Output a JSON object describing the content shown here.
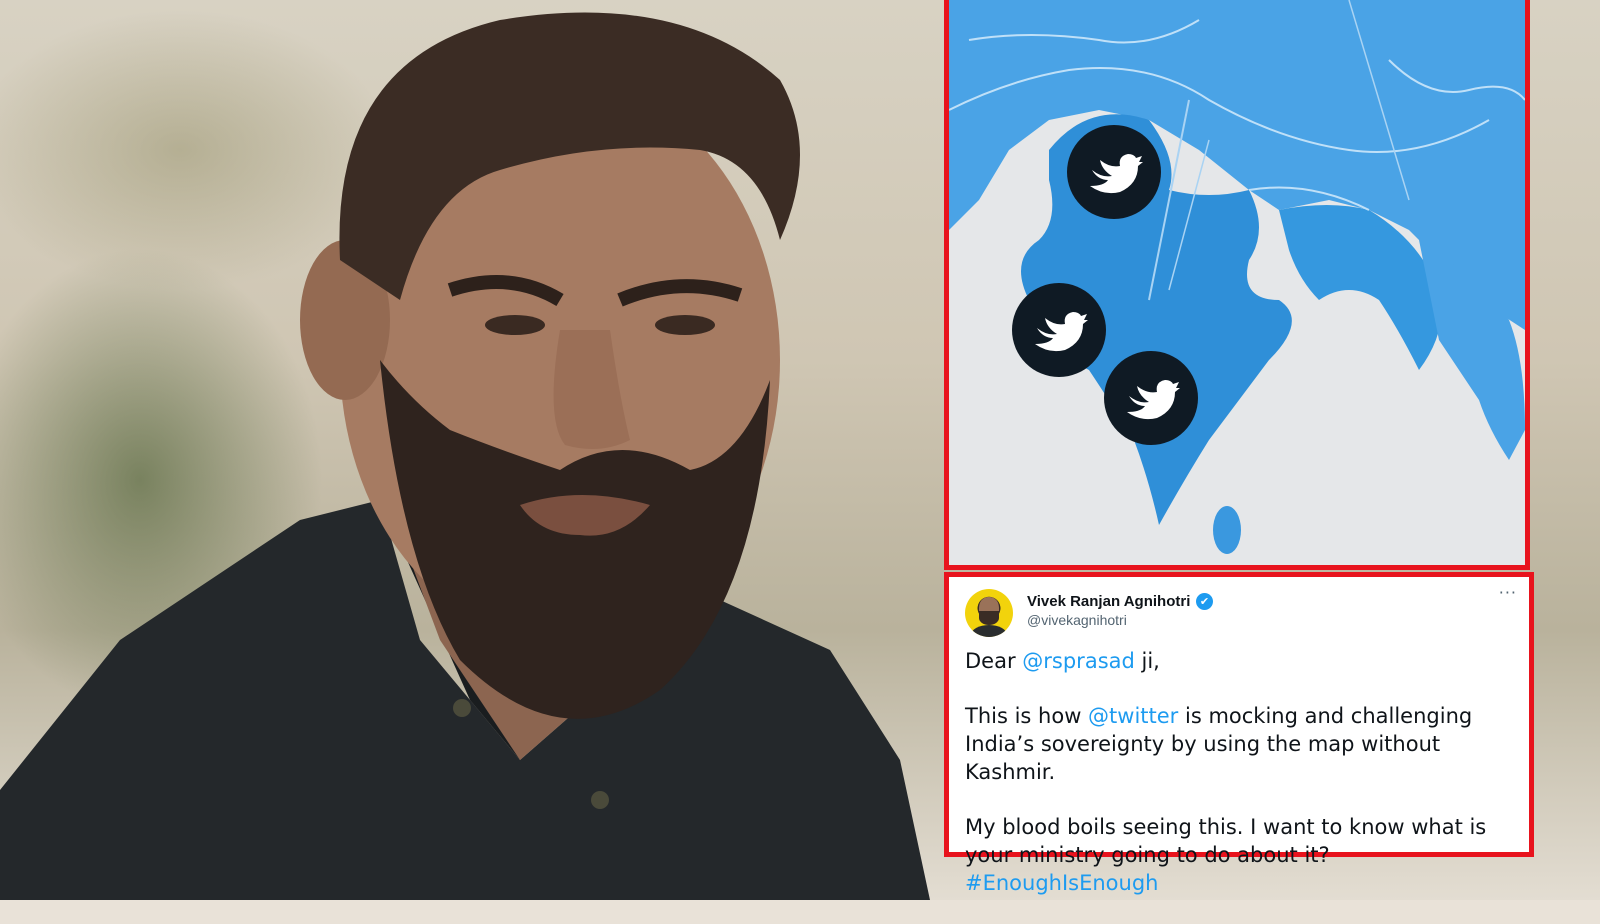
{
  "tweet": {
    "author_name": "Vivek Ranjan Agnihotri",
    "author_handle": "@vivekagnihotri",
    "verified_icon": "✔",
    "more_label": "···",
    "p1": {
      "a": "Dear ",
      "mention": "@rsprasad",
      "b": " ji,"
    },
    "p2": {
      "a": "This is how ",
      "mention": "@twitter",
      "b": " is mocking and challenging India’s sovereignty by using the map without Kashmir."
    },
    "p3": {
      "a": "My blood boils seeing this. I want to know what is your ministry going to do about it? ",
      "hashtag": "#EnoughIsEnough"
    }
  },
  "colors": {
    "frame": "#e8131d",
    "link": "#1d9bf0",
    "map_blue": "#2f8fd8",
    "map_light": "#6cb4ea"
  },
  "map": {
    "pins": [
      "twitter-bird-icon",
      "twitter-bird-icon",
      "twitter-bird-icon"
    ]
  }
}
